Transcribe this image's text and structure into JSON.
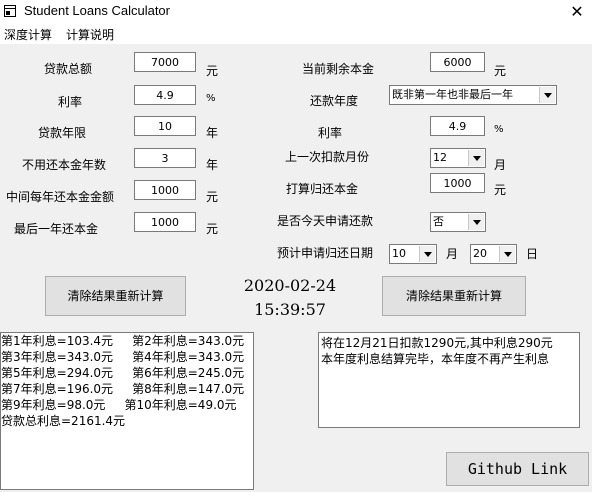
{
  "window": {
    "title": "Student Loans Calculator",
    "close_glyph": "✕",
    "icon": "app-window-icon"
  },
  "menu": {
    "items": [
      "深度计算",
      "计算说明"
    ]
  },
  "left_form": {
    "total_label": "贷款总额",
    "total_value": "7000",
    "total_unit": "元",
    "rate_label": "利率",
    "rate_value": "4.9",
    "rate_unit": "%",
    "years_label": "贷款年限",
    "years_value": "10",
    "years_unit": "年",
    "grace_label": "不用还本金年数",
    "grace_value": "3",
    "grace_unit": "年",
    "mid_label": "中间每年还本金金额",
    "mid_value": "1000",
    "mid_unit": "元",
    "last_label": "最后一年还本金",
    "last_value": "1000",
    "last_unit": "元"
  },
  "right_form": {
    "remain_label": "当前剩余本金",
    "remain_value": "6000",
    "remain_unit": "元",
    "year_label": "还款年度",
    "year_value": "既非第一年也非最后一年",
    "rate_label": "利率",
    "rate_value": "4.9",
    "rate_unit": "%",
    "lastmonth_label": "上一次扣款月份",
    "lastmonth_value": "12",
    "lastmonth_unit": "月",
    "repay_label": "打算归还本金",
    "repay_value": "1000",
    "repay_unit": "元",
    "today_label": "是否今天申请还款",
    "today_value": "否",
    "date_label": "预计申请归还日期",
    "month_value": "10",
    "month_unit": "月",
    "day_value": "20",
    "day_unit": "日"
  },
  "buttons": {
    "recalc_left": "清除结果重新计算",
    "recalc_right": "清除结果重新计算",
    "github": "Github Link"
  },
  "clock": {
    "date": "2020-02-24",
    "time": "15:39:57"
  },
  "output_left": [
    "第1年利息=103.4元     第2年利息=343.0元",
    "第3年利息=343.0元     第4年利息=343.0元",
    "第5年利息=294.0元     第6年利息=245.0元",
    "第7年利息=196.0元     第8年利息=147.0元",
    "第9年利息=98.0元     第10年利息=49.0元",
    "贷款总利息=2161.4元"
  ],
  "output_right": [
    "将在12月21日扣款1290元,其中利息290元",
    "本年度利息结算完毕，本年度不再产生利息"
  ]
}
